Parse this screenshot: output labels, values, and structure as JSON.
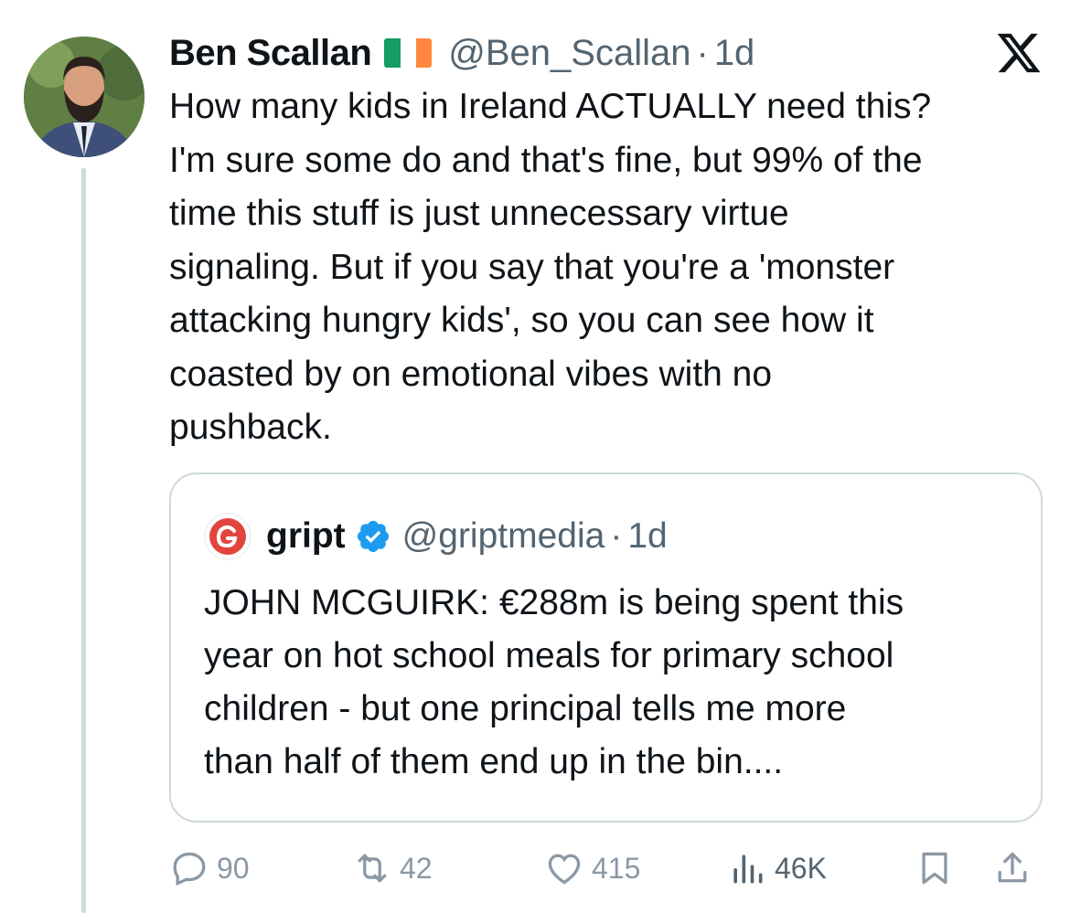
{
  "author": {
    "name": "Ben Scallan",
    "flag": "Irish flag",
    "handle": "@Ben_Scallan",
    "separator": "·",
    "time": "1d"
  },
  "brand_icon": "x-logo-icon",
  "tweet_text": "How many kids in Ireland ACTUALLY need this?\nI'm sure some do and that's fine, but 99% of the\ntime this stuff is just unnecessary virtue\nsignaling. But if you say that you're a 'monster\nattacking hungry kids', so you can see how it\ncoasted by on emotional vibes with no\npushback.",
  "quote": {
    "name": "gript",
    "verified": true,
    "handle": "@griptmedia",
    "separator": "·",
    "time": "1d",
    "text": "JOHN MCGUIRK: €288m is being spent this\nyear on hot school meals for primary school\nchildren - but one principal tells me more\nthan half of them end up in the bin...."
  },
  "actions": {
    "replies": "90",
    "reposts": "42",
    "likes": "415",
    "views": "46K"
  },
  "colors": {
    "text": "#0f1419",
    "secondary": "#536471",
    "muted": "#8b98a5",
    "border": "#cfd9de",
    "verified": "#1d9bf0",
    "gript_red": "#e2453c"
  }
}
